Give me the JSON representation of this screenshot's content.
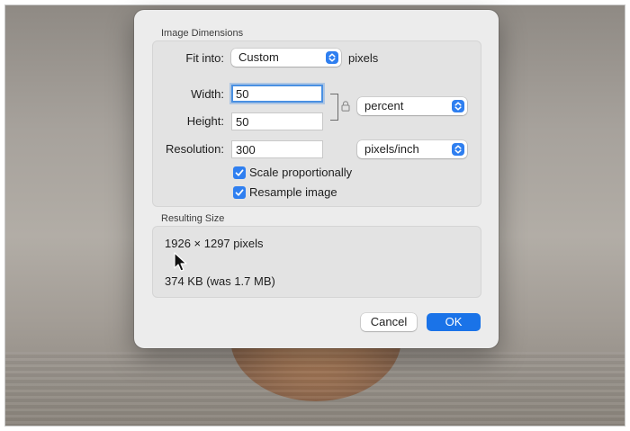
{
  "dialog": {
    "image_dimensions": {
      "section_title": "Image Dimensions",
      "fit_into": {
        "label": "Fit into:",
        "value": "Custom",
        "unit": "pixels"
      },
      "width": {
        "label": "Width:",
        "value": "50"
      },
      "height": {
        "label": "Height:",
        "value": "50"
      },
      "size_unit": {
        "value": "percent"
      },
      "resolution": {
        "label": "Resolution:",
        "value": "300",
        "unit": "pixels/inch"
      },
      "scale_proportionally": {
        "label": "Scale proportionally",
        "checked": true
      },
      "resample_image": {
        "label": "Resample image",
        "checked": true
      }
    },
    "resulting_size": {
      "section_title": "Resulting Size",
      "pixels": "1926 × 1297 pixels",
      "file_size": "374 KB (was 1.7 MB)"
    },
    "buttons": {
      "cancel": "Cancel",
      "ok": "OK"
    }
  },
  "colors": {
    "accent": "#2f7ff0",
    "ok_button": "#1a73e8",
    "dialog_bg": "#ececec"
  },
  "icons": [
    "popup-chevrons-icon",
    "checkmark-icon",
    "lock-icon",
    "pointer-cursor-icon"
  ]
}
